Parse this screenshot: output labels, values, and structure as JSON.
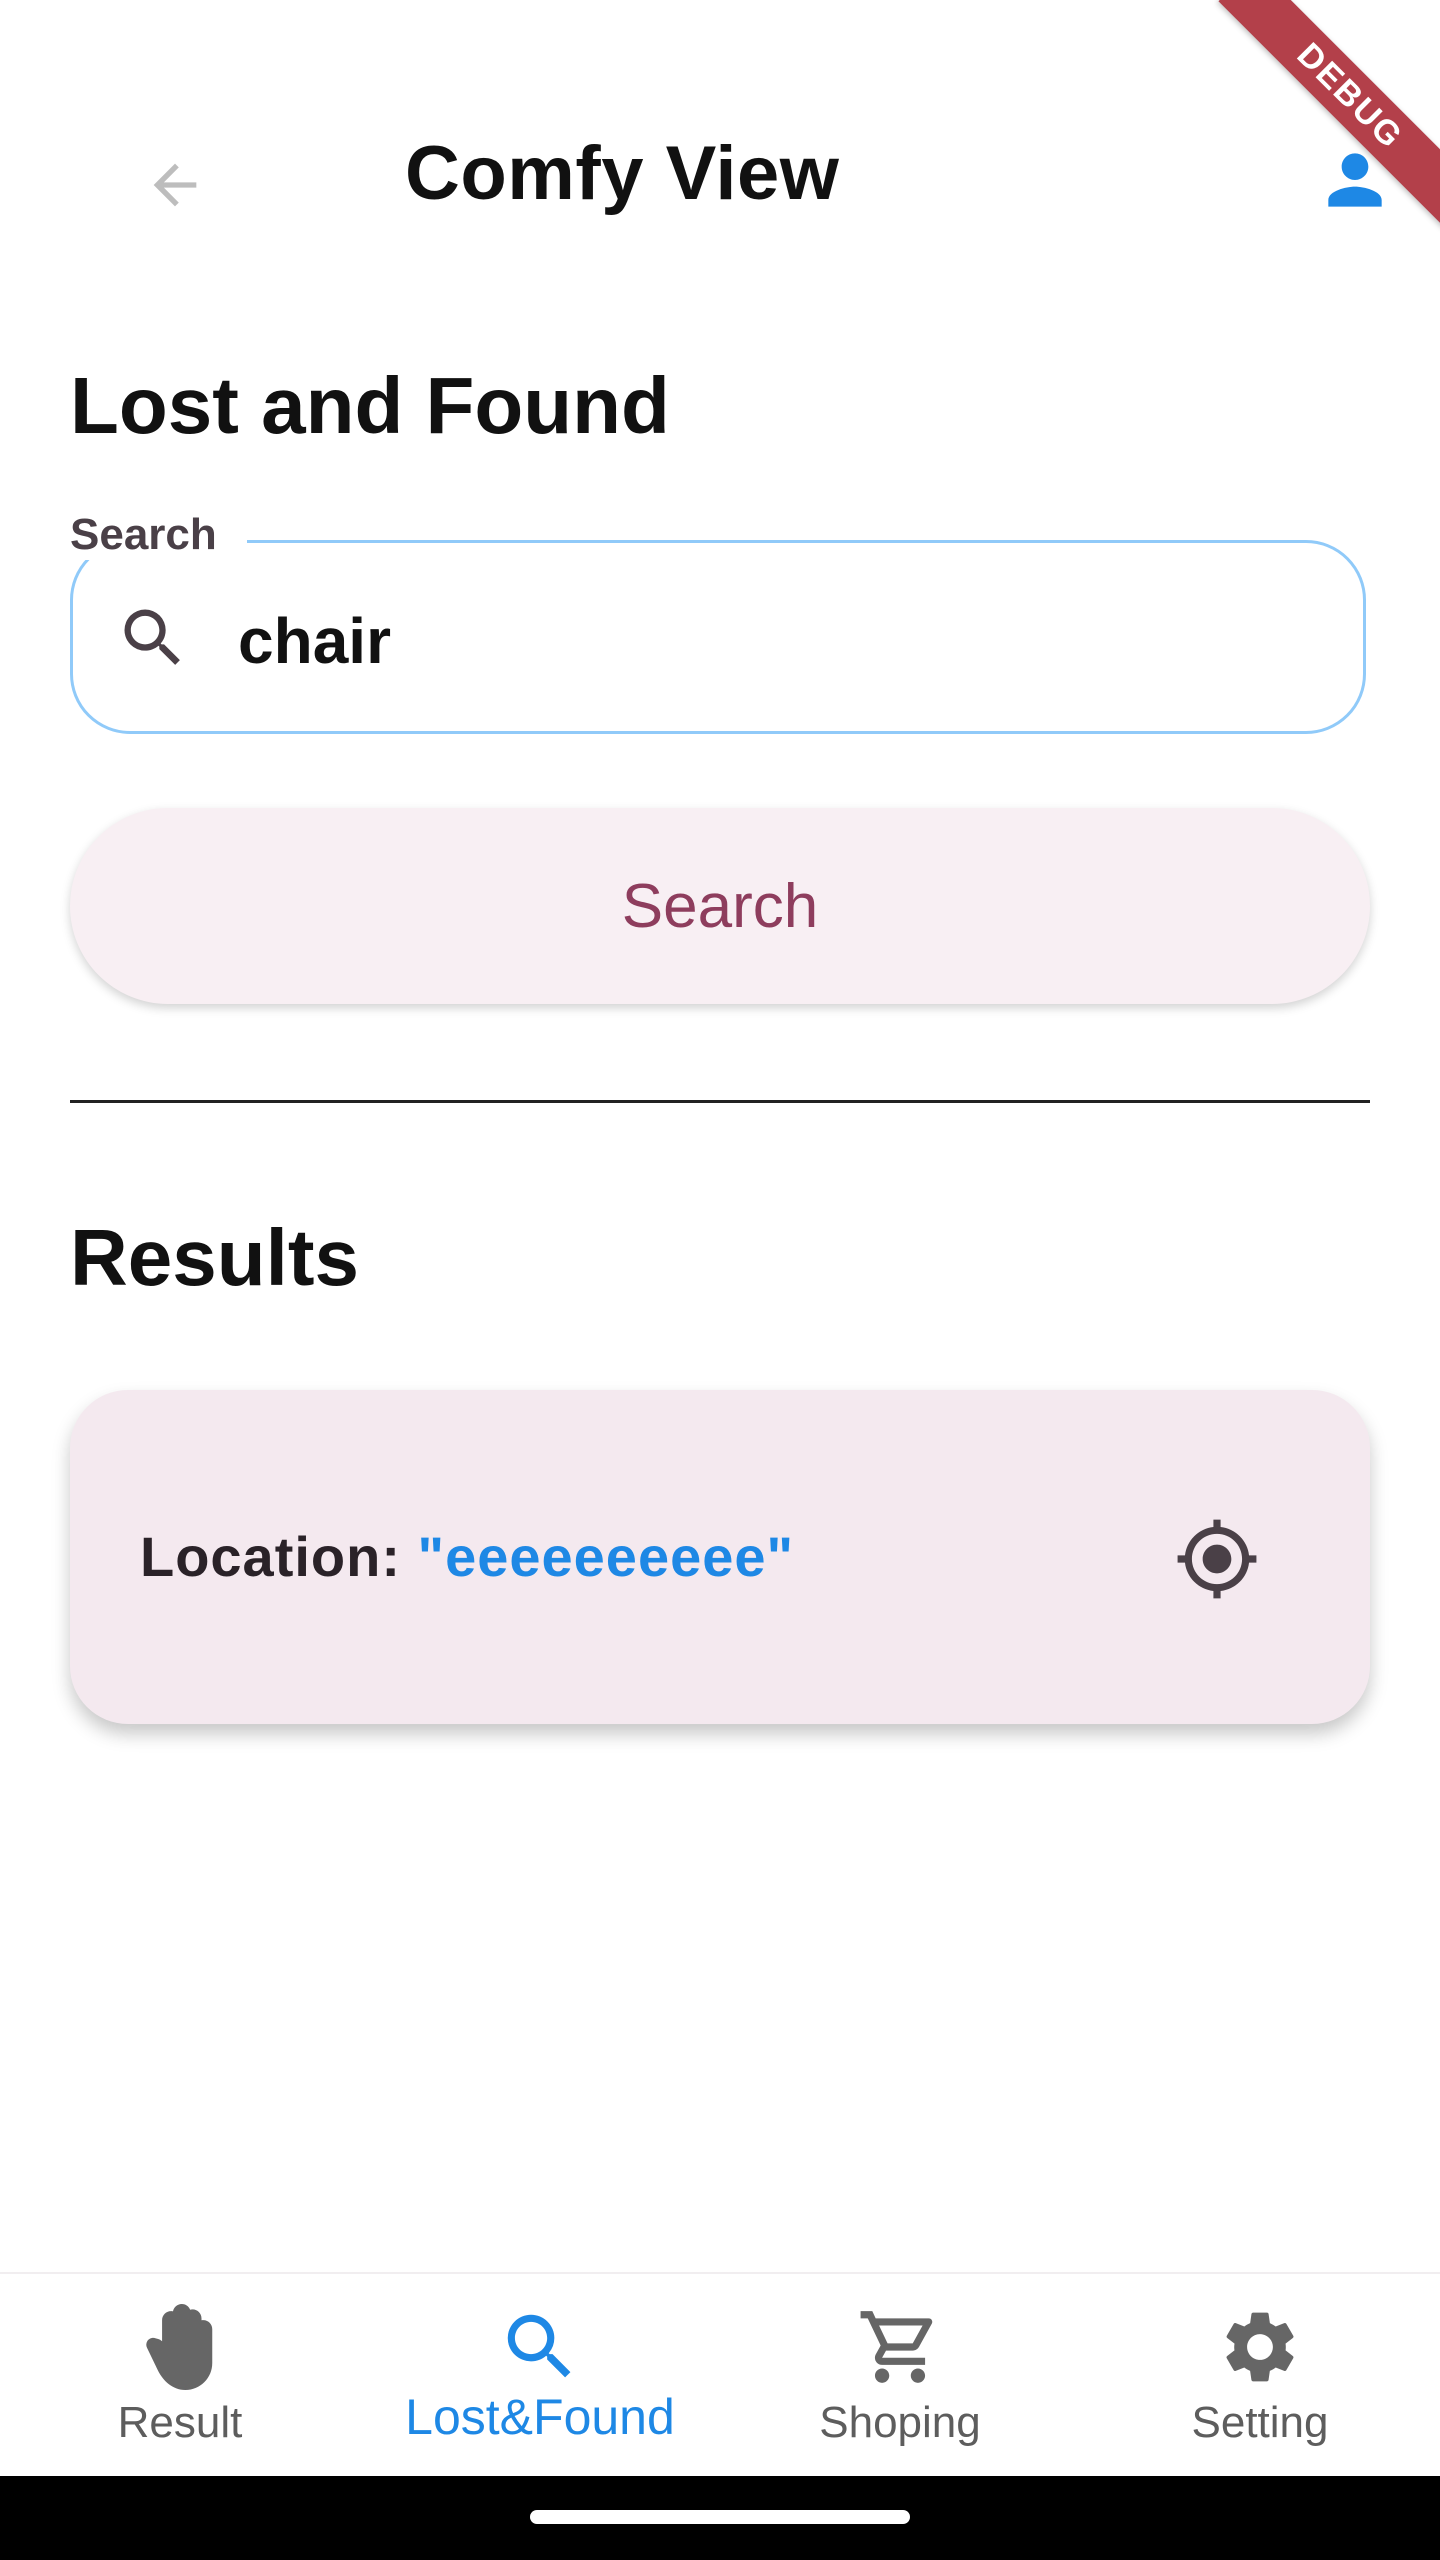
{
  "app_bar": {
    "title": "Comfy View",
    "debug_banner": "DEBUG",
    "back_icon": "arrow-back-icon",
    "profile_icon": "person-icon"
  },
  "lost_found": {
    "heading": "Lost and Found",
    "search_label": "Search",
    "search_value": "chair",
    "search_button": "Search"
  },
  "results": {
    "heading": "Results",
    "items": [
      {
        "location_label": "Location: ",
        "location_value": "\"eeeeeeeeee\"",
        "action_icon": "my-location-icon"
      }
    ]
  },
  "bottom_nav": {
    "items": [
      {
        "label": "Result",
        "icon": "hand-icon",
        "active": false
      },
      {
        "label": "Lost&Found",
        "icon": "search-icon",
        "active": true
      },
      {
        "label": "Shoping",
        "icon": "cart-icon",
        "active": false
      },
      {
        "label": "Setting",
        "icon": "gear-icon",
        "active": false
      }
    ]
  },
  "colors": {
    "accent": "#1e88e5",
    "button_text": "#8e3d5d",
    "button_bg": "#f8eff3",
    "card_bg": "#f4e9ef",
    "field_border": "#90caf9",
    "debug_ribbon": "#b3404a"
  }
}
